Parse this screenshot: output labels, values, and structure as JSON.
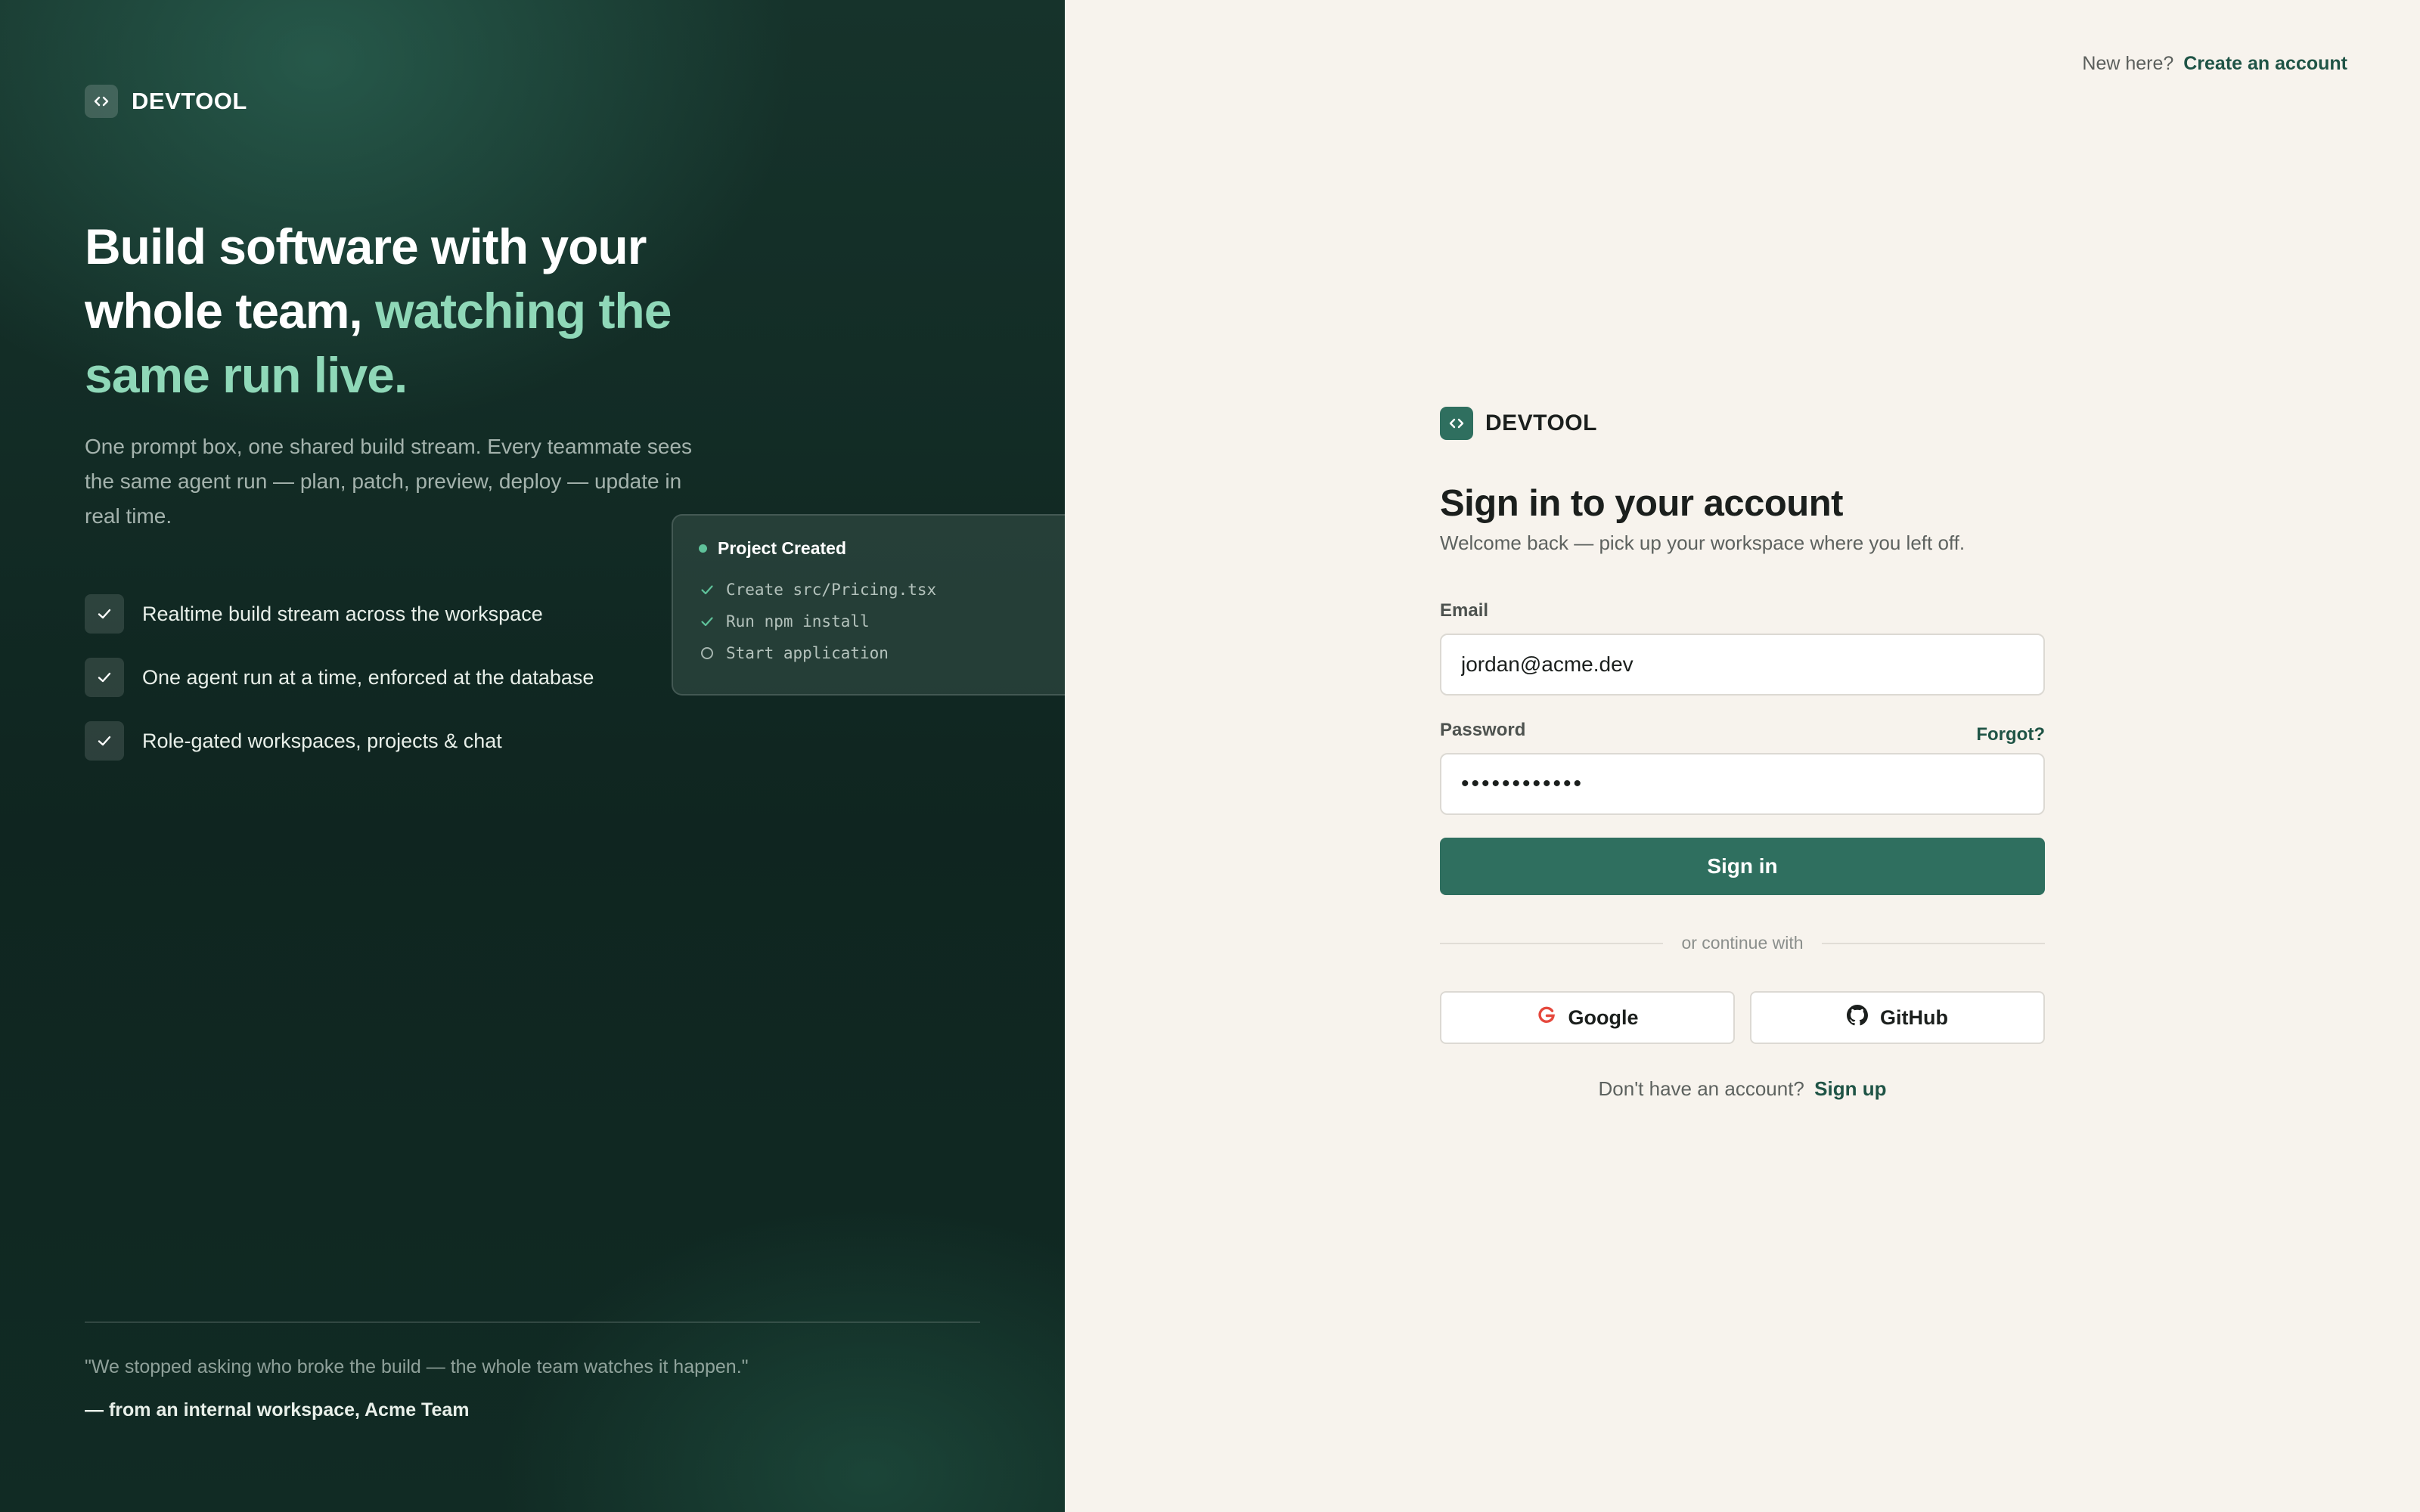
{
  "brand": {
    "name": "DEVTOOL"
  },
  "hero": {
    "title_part1": "Build software with your whole team,",
    "title_accent": "watching the same run live.",
    "subtitle": "One prompt box, one shared build stream. Every teammate sees the same agent run — plan, patch, preview, deploy — update in real time."
  },
  "features": [
    {
      "label": "Realtime build stream across the workspace"
    },
    {
      "label": "One agent run at a time, enforced at the database"
    },
    {
      "label": "Role-gated workspaces, projects & chat"
    }
  ],
  "run_card": {
    "title": "Project Created",
    "steps": [
      {
        "text": "Create src/Pricing.tsx",
        "status": "done"
      },
      {
        "text": "Run npm install",
        "status": "done"
      },
      {
        "text": "Start application",
        "status": "pending"
      }
    ]
  },
  "testimonial": {
    "quote": "\"We stopped asking who broke the build — the whole team watches it happen.\"",
    "attribution": "— from an internal workspace, Acme Team"
  },
  "top_nav": {
    "prompt": "New here?",
    "link": "Create an account"
  },
  "form": {
    "title": "Sign in to your account",
    "subtitle": "Welcome back — pick up your workspace where you left off.",
    "email_label": "Email",
    "email_value": "jordan@acme.dev",
    "password_label": "Password",
    "password_value": "passwordabcd",
    "forgot_label": "Forgot?",
    "submit_label": "Sign in",
    "divider_text": "or continue with",
    "google_label": "Google",
    "github_label": "GitHub",
    "signup_prompt": "Don't have an account?",
    "signup_link": "Sign up"
  },
  "colors": {
    "accent": "#2f6f5f",
    "accent_light": "#8fd8b8",
    "panel_dark": "#12302a",
    "background": "#f7f3ed",
    "google_red": "#e5483d"
  }
}
